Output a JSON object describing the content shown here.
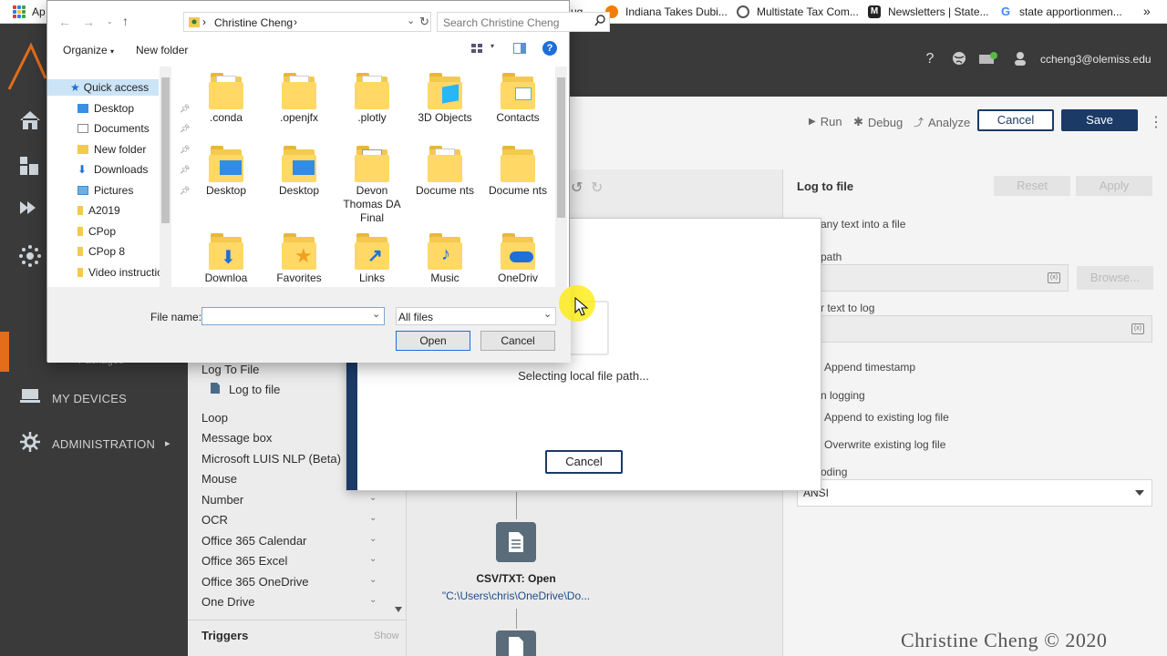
{
  "bookmarks": {
    "apps_partial": "Ap",
    "prev_partial": "ug...",
    "items": [
      {
        "label": "Indiana Takes Dubi...",
        "icon": "indiana-icon",
        "color": "#f57c00"
      },
      {
        "label": "Multistate Tax Com...",
        "icon": "globe-icon",
        "color": "#555555"
      },
      {
        "label": "Newsletters | State...",
        "icon": "m-logo-icon",
        "color": "#222222"
      },
      {
        "label": "state apportionmen...",
        "icon": "google-icon",
        "color": "#4285f4"
      }
    ],
    "overflow": "»"
  },
  "header": {
    "user_email": "ccheng3@olemiss.edu",
    "icons": [
      "help-icon",
      "globe-icon",
      "bot-icon",
      "user-icon"
    ]
  },
  "leftnav": {
    "items": [
      {
        "label": "MY DEVICES",
        "icon": "monitor-icon"
      },
      {
        "label": "ADMINISTRATION",
        "icon": "gear-icon"
      }
    ],
    "partial_label": "Packages",
    "expand_glyph": "▸"
  },
  "actions": {
    "items": [
      {
        "label": "Log To File",
        "expandable": false
      },
      {
        "label": "Log to file",
        "child": true
      },
      {
        "label": "Loop",
        "expandable": false
      },
      {
        "label": "Message box",
        "expandable": false
      },
      {
        "label": "Microsoft LUIS NLP (Beta)",
        "expandable": false
      },
      {
        "label": "Mouse",
        "expandable": false
      },
      {
        "label": "Number",
        "expandable": true
      },
      {
        "label": "OCR",
        "expandable": true
      },
      {
        "label": "Office 365 Calendar",
        "expandable": true
      },
      {
        "label": "Office 365 Excel",
        "expandable": true
      },
      {
        "label": "Office 365 OneDrive",
        "expandable": true
      },
      {
        "label": "One Drive",
        "expandable": true
      }
    ],
    "triggers_label": "Triggers",
    "triggers_show": "Show",
    "chevron": "⌄"
  },
  "toolbar": {
    "run": "Run",
    "debug": "Debug",
    "analyze": "Analyze",
    "cancel": "Cancel",
    "save": "Save"
  },
  "canvas": {
    "node_title": "CSV/TXT: Open",
    "node_path": "\"C:\\Users\\chris\\OneDrive\\Do..."
  },
  "props": {
    "title": "Log to file",
    "reset": "Reset",
    "apply": "Apply",
    "desc_partial": "any text into a file",
    "path_label_partial": "path",
    "browse": "Browse...",
    "text_label_partial": "r text to log",
    "append_timestamp": "Append timestamp",
    "when_logging_partial": "n logging",
    "append_existing": "Append to existing log file",
    "overwrite_existing": "Overwrite existing log file",
    "encoding_partial": "oding",
    "encoding_value": "ANSI",
    "badge": "(x)"
  },
  "modal": {
    "message": "Selecting local file path...",
    "cancel": "Cancel"
  },
  "file_dialog": {
    "breadcrumb": "Christine Cheng",
    "breadcrumb_sep": "›",
    "search_placeholder": "Search Christine Cheng",
    "organize": "Organize",
    "new_folder": "New folder",
    "tree": [
      {
        "label": "Quick access",
        "icon": "star-icon",
        "pinned": false
      },
      {
        "label": "Desktop",
        "icon": "desktop-icon",
        "pinned": true
      },
      {
        "label": "Documents",
        "icon": "documents-icon",
        "pinned": true
      },
      {
        "label": "New folder",
        "icon": "folder-icon",
        "pinned": true
      },
      {
        "label": "Downloads",
        "icon": "downloads-icon",
        "pinned": true
      },
      {
        "label": "Pictures",
        "icon": "pictures-icon",
        "pinned": true
      },
      {
        "label": "A2019",
        "icon": "folder-icon",
        "pinned": false
      },
      {
        "label": "CPop",
        "icon": "folder-icon",
        "pinned": false
      },
      {
        "label": "CPop 8",
        "icon": "folder-icon",
        "pinned": false
      },
      {
        "label": "Video instructio",
        "icon": "folder-icon",
        "pinned": false
      }
    ],
    "files": [
      {
        "label": ".conda",
        "kind": "paper"
      },
      {
        "label": ".openjfx",
        "kind": "paper"
      },
      {
        "label": ".plotly",
        "kind": "paper"
      },
      {
        "label": "3D Objects",
        "kind": "cube"
      },
      {
        "label": "Contacts",
        "kind": "contacts"
      },
      {
        "label": "Desktop",
        "kind": "desktop"
      },
      {
        "label": "Desktop",
        "kind": "desktop"
      },
      {
        "label": "Devon Thomas DA Final",
        "kind": "excel"
      },
      {
        "label": "Docume nts",
        "kind": "paper"
      },
      {
        "label": "Docume nts",
        "kind": "plain"
      },
      {
        "label": "Downloa",
        "kind": "download"
      },
      {
        "label": "Favorites",
        "kind": "star"
      },
      {
        "label": "Links",
        "kind": "link"
      },
      {
        "label": "Music",
        "kind": "music"
      },
      {
        "label": "OneDriv",
        "kind": "cloud"
      }
    ],
    "file_name_label": "File name:",
    "file_name_value": "",
    "file_type": "All files",
    "open": "Open",
    "cancel": "Cancel"
  },
  "watermark": "Christine Cheng © 2020"
}
